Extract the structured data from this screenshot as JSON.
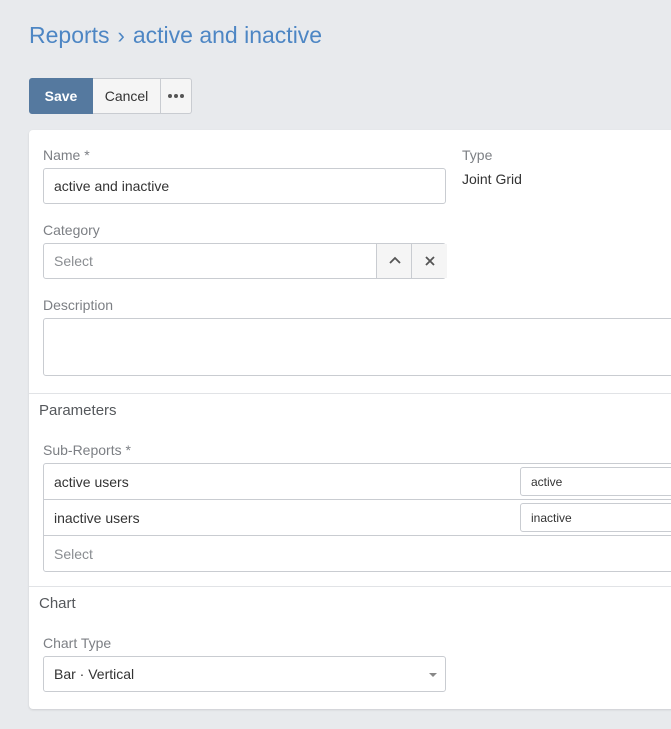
{
  "breadcrumb": {
    "parent": "Reports",
    "separator": "›",
    "current": "active and inactive"
  },
  "toolbar": {
    "save_label": "Save",
    "cancel_label": "Cancel",
    "more_icon": "ellipsis-icon"
  },
  "form": {
    "name_label": "Name *",
    "name_value": "active and inactive",
    "type_label": "Type",
    "type_value": "Joint Grid",
    "category_label": "Category",
    "category_placeholder": "Select",
    "description_label": "Description",
    "description_value": ""
  },
  "parameters": {
    "section_title": "Parameters",
    "subreports_label": "Sub-Reports *",
    "subreports": [
      {
        "name": "active users",
        "alias": "active"
      },
      {
        "name": "inactive users",
        "alias": "inactive"
      }
    ],
    "select_placeholder": "Select"
  },
  "chart": {
    "section_title": "Chart",
    "chart_type_label": "Chart Type",
    "chart_type_value": "Bar · Vertical"
  }
}
